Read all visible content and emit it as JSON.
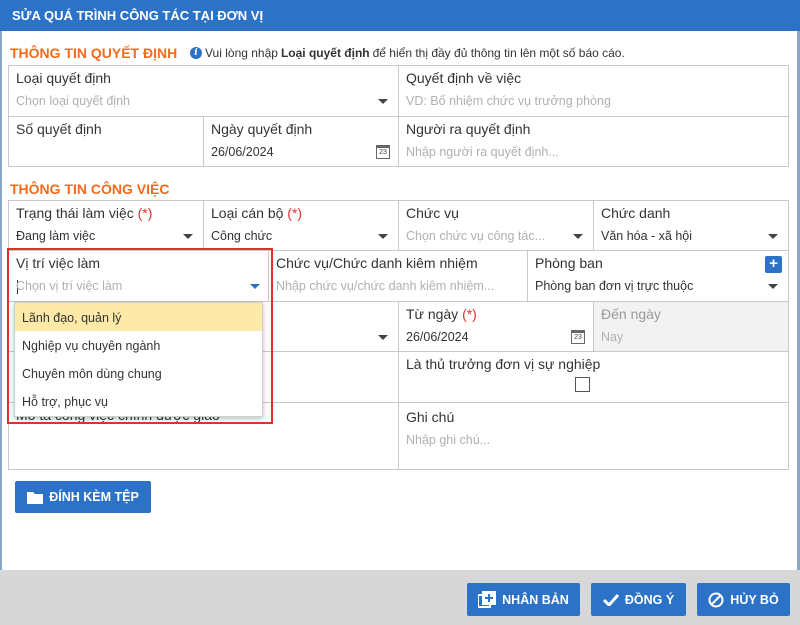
{
  "dialog": {
    "title": "SỬA QUÁ TRÌNH CÔNG TÁC TẠI ĐƠN VỊ"
  },
  "decision_section": {
    "title": "THÔNG TIN QUYẾT ĐỊNH",
    "info_prefix": "Vui lòng nhập",
    "info_bold": "Loại quyết định",
    "info_suffix": "để hiển thị đầy đủ thông tin lên một số báo cáo.",
    "loai_qd": {
      "label": "Loại quyết định",
      "placeholder": "Chọn loại quyết định"
    },
    "qd_ve_viec": {
      "label": "Quyết định về việc",
      "placeholder": "VD: Bổ nhiệm chức vụ trưởng phòng"
    },
    "so_qd": {
      "label": "Số quyết định",
      "value": ""
    },
    "ngay_qd": {
      "label": "Ngày quyết định",
      "value": "26/06/2024"
    },
    "nguoi_ra_qd": {
      "label": "Người ra quyết định",
      "placeholder": "Nhập người ra quyết định..."
    }
  },
  "job_section": {
    "title": "THÔNG TIN CÔNG VIỆC",
    "trang_thai": {
      "label": "Trạng thái làm việc",
      "req": "(*)",
      "value": "Đang làm việc"
    },
    "loai_can_bo": {
      "label": "Loại cán bộ",
      "req": "(*)",
      "value": "Công chức"
    },
    "chuc_vu": {
      "label": "Chức vụ",
      "placeholder": "Chọn chức vụ công tác..."
    },
    "chuc_danh": {
      "label": "Chức danh",
      "value": "Văn hóa - xã hội"
    },
    "vi_tri": {
      "label": "Vị trí việc làm",
      "placeholder": "Chọn vị trí việc làm"
    },
    "kiem_nhiem": {
      "label": "Chức vụ/Chức danh kiêm nhiệm",
      "placeholder": "Nhập chức vụ/chức danh kiêm nhiệm..."
    },
    "phong_ban": {
      "label": "Phòng ban",
      "value": "Phòng ban đơn vị trực thuộc"
    },
    "tu_ngay": {
      "label": "Từ ngày",
      "req": "(*)",
      "value": "26/06/2024"
    },
    "den_ngay": {
      "label": "Đến ngày",
      "placeholder": "Nay"
    },
    "thu_truong": {
      "label": "Là thủ trưởng đơn vị sự nghiệp"
    },
    "mo_ta": {
      "label": "Mô tả công việc chính được giao"
    },
    "ghi_chu": {
      "label": "Ghi chú",
      "placeholder": "Nhập ghi chú..."
    }
  },
  "dropdown": {
    "options": [
      "Lãnh đạo, quản lý",
      "Nghiệp vụ chuyên ngành",
      "Chuyên môn dùng chung",
      "Hỗ trợ, phục vụ"
    ]
  },
  "attach_button": "ĐÍNH KÈM TỆP",
  "footer": {
    "duplicate": "NHÂN BẢN",
    "ok": "ĐỒNG Ý",
    "cancel": "HỦY BỎ"
  },
  "colors": {
    "primary": "#2c73c8",
    "section": "#f26b1d",
    "required": "#e0312d",
    "highlight": "#fde9a8"
  }
}
